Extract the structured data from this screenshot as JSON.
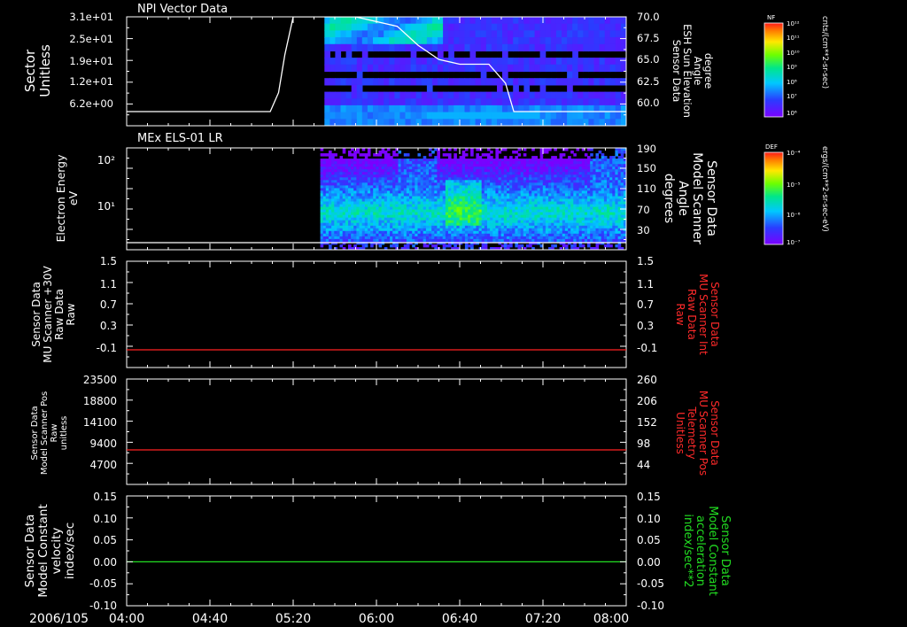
{
  "page": {
    "date_label": "2006/105"
  },
  "time_axis": {
    "range": [
      "04:00",
      "08:00"
    ],
    "ticks": [
      "04:00",
      "04:40",
      "05:20",
      "06:00",
      "06:40",
      "07:20",
      "08:00"
    ]
  },
  "colors": {
    "background": "#000000",
    "axis": "#ffffff",
    "red_trace": "#ff2222",
    "green_trace": "#22dd22",
    "red_label": "#ff2a2a",
    "green_label": "#22dd22"
  },
  "colorbars": [
    {
      "tag": "NF",
      "unit": "cnts/(cm**2-sr-sec)",
      "ticks": [
        "10¹²",
        "10¹¹",
        "10¹⁰",
        "10⁹",
        "10⁸",
        "10⁷",
        "10⁶"
      ]
    },
    {
      "tag": "DEF",
      "unit": "ergs/(cm**2-sr-sec-eV)",
      "ticks": [
        "10⁻⁴",
        "10⁻⁵",
        "10⁻⁶",
        "10⁻⁷"
      ]
    }
  ],
  "chart_data": [
    {
      "type": "heatmap",
      "title": "NPI Vector Data",
      "ylabel_lines": [
        "Sector",
        "Unitless"
      ],
      "yticks": [
        "3.1e+01",
        "2.5e+01",
        "1.9e+01",
        "1.2e+01",
        "6.2e+00"
      ],
      "y2label_lines": [
        "Sensor Data",
        "ESH Sun Elevation",
        "Angle",
        "degree"
      ],
      "y2ticks": [
        "70.0",
        "67.5",
        "65.0",
        "62.5",
        "60.0"
      ],
      "y2lim": [
        58.5,
        70.0
      ],
      "data_start": "05:35",
      "overlay": {
        "name": "ESH Sun Elevation Angle",
        "unit": "degree",
        "points": [
          [
            "04:00",
            60.0
          ],
          [
            "05:09",
            60.0
          ],
          [
            "05:13",
            62.0
          ],
          [
            "05:16",
            66.0
          ],
          [
            "05:20",
            70.0
          ],
          [
            "05:30",
            70.0
          ],
          [
            "05:50",
            70.0
          ],
          [
            "06:10",
            69.0
          ],
          [
            "06:20",
            67.0
          ],
          [
            "06:30",
            65.5
          ],
          [
            "06:40",
            65.0
          ],
          [
            "06:54",
            65.0
          ],
          [
            "07:02",
            63.0
          ],
          [
            "07:06",
            60.0
          ],
          [
            "08:00",
            60.0
          ]
        ]
      }
    },
    {
      "type": "heatmap",
      "title": "MEx ELS-01 LR",
      "ylabel_lines": [
        "Electron Energy",
        "eV"
      ],
      "yticks": [
        "10²",
        "10¹"
      ],
      "ylim": [
        1.6,
        180
      ],
      "y2label_lines": [
        "Sensor Data",
        "Model Scanner",
        "Angle",
        "degrees"
      ],
      "y2ticks": [
        "190",
        "150",
        "110",
        "70",
        "30"
      ],
      "y2lim": [
        3,
        190
      ],
      "data_start": "05:33",
      "overlay": {
        "name": "Model Scanner Angle",
        "points": [
          [
            "04:00",
            12
          ],
          [
            "08:00",
            12
          ]
        ]
      }
    },
    {
      "type": "line",
      "title": "",
      "ylabel_lines": [
        "Sensor Data",
        "MU Scanner +30V",
        "Raw Data",
        "Raw"
      ],
      "yticks": [
        "1.5",
        "1.1",
        "0.7",
        "0.3",
        "-0.1"
      ],
      "ylim": [
        -0.3,
        1.5
      ],
      "y2label_lines": [
        "Sensor Data",
        "MU Scanner Int",
        "Raw Data",
        "Raw"
      ],
      "y2ticks": [
        "1.5",
        "1.1",
        "0.7",
        "0.3",
        "-0.1"
      ],
      "y2lim": [
        -0.3,
        1.5
      ],
      "series": [
        {
          "name": "MU Scanner +30V",
          "y": 0.0,
          "color": "#ff2222"
        }
      ]
    },
    {
      "type": "line",
      "title": "",
      "ylabel_lines": [
        "Sensor Data",
        "Model Scanner Pos",
        "Raw",
        "unitless"
      ],
      "yticks": [
        "23500",
        "18800",
        "14100",
        "9400",
        "4700"
      ],
      "ylim": [
        0,
        23500
      ],
      "y2label_lines": [
        "Sensor Data",
        "MU Scanner Pos",
        "Telemetry",
        "Unitless"
      ],
      "y2ticks": [
        "260",
        "206",
        "152",
        "98",
        "44"
      ],
      "y2lim": [
        0,
        260
      ],
      "series": [
        {
          "name": "Model Scanner Pos",
          "y": 7700,
          "color": "#ff2222"
        }
      ]
    },
    {
      "type": "line",
      "title": "",
      "ylabel_lines": [
        "Sensor Data",
        "Model Constant",
        "velocity",
        "index/sec"
      ],
      "yticks": [
        "0.15",
        "0.10",
        "0.05",
        "0.00",
        "-0.05",
        "-0.10"
      ],
      "ylim": [
        -0.1,
        0.15
      ],
      "y2label_lines": [
        "Sensor Data",
        "Model Constant",
        "acceleration",
        "index/sec**2"
      ],
      "y2ticks": [
        "0.15",
        "0.10",
        "0.05",
        "0.00",
        "-0.05",
        "-0.10"
      ],
      "y2lim": [
        -0.1,
        0.15
      ],
      "series": [
        {
          "name": "Model Constant velocity",
          "y": 0.0,
          "color": "#22dd22"
        }
      ]
    }
  ]
}
